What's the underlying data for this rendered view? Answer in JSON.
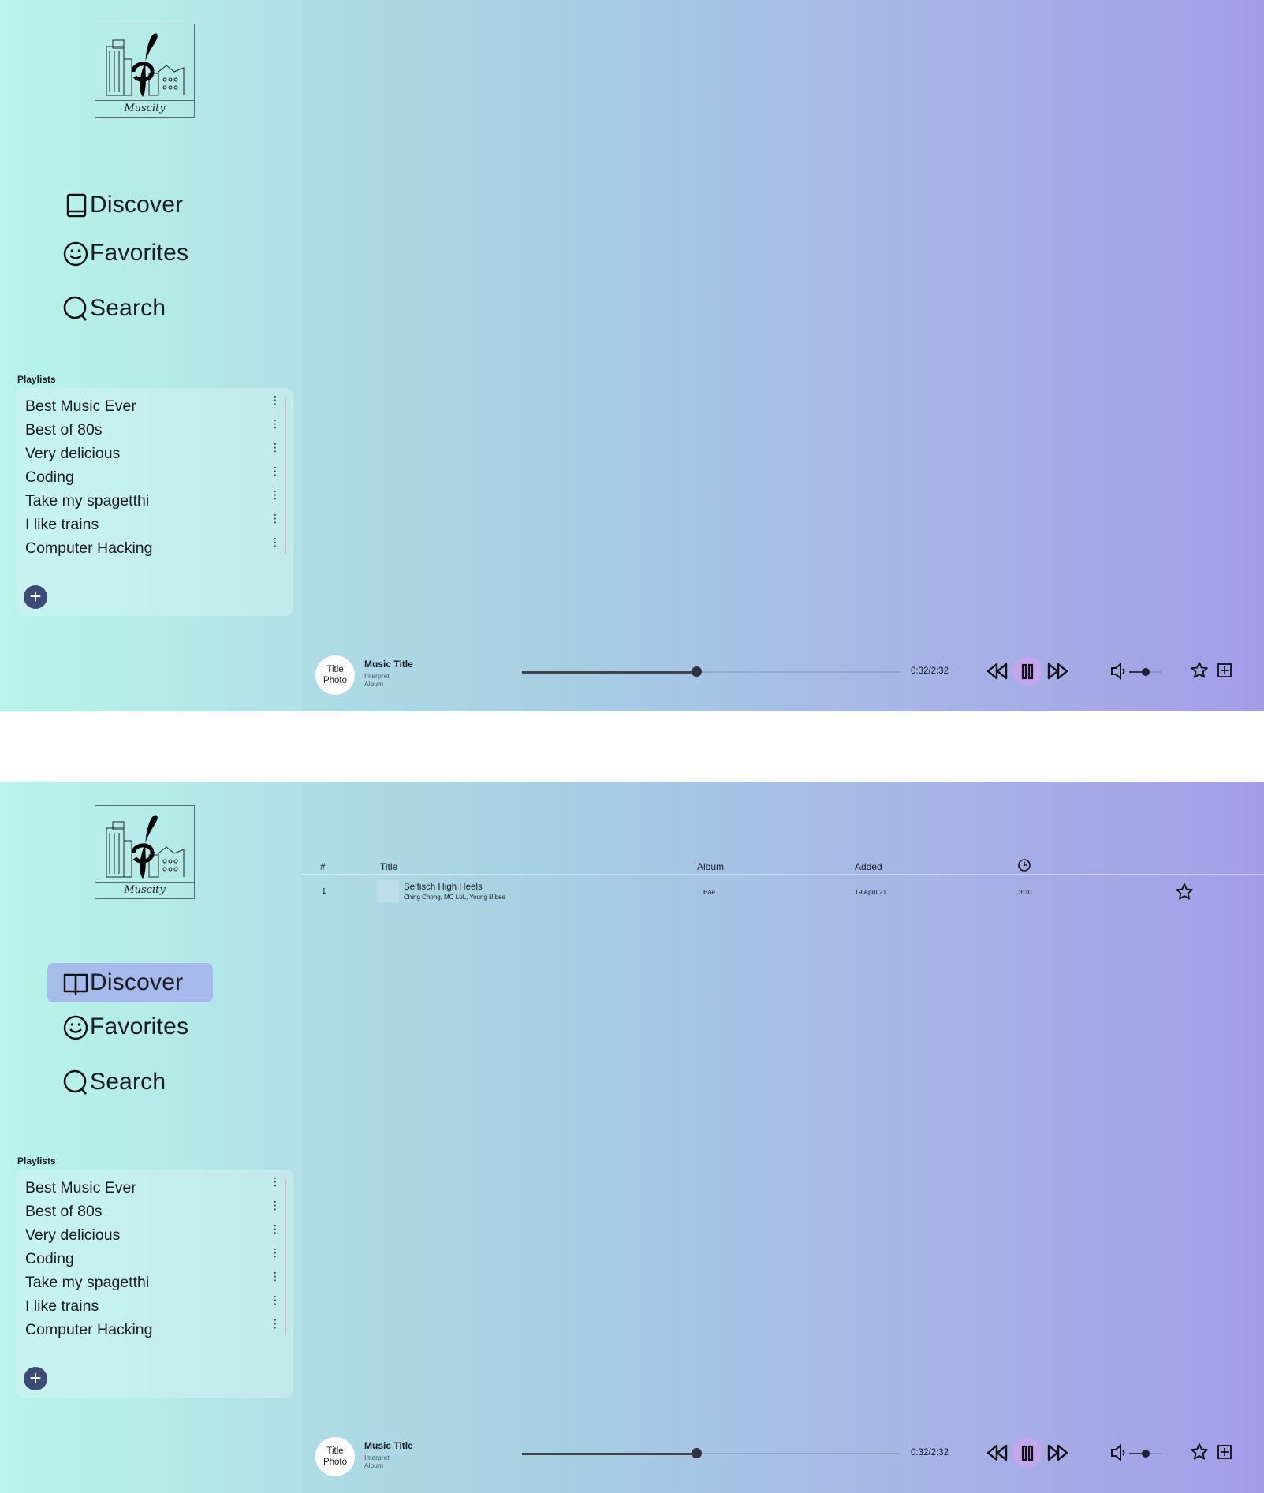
{
  "app": {
    "logo_text": "Muscity"
  },
  "nav": {
    "discover": "Discover",
    "favorites": "Favorites",
    "search": "Search"
  },
  "playlists": {
    "title": "Playlists",
    "items": [
      "Best Music Ever",
      "Best of 80s",
      "Very delicious",
      "Coding",
      "Take my spagetthi",
      "I like trains",
      "Computer Hacking"
    ],
    "more_glyph": "⋮",
    "add_glyph": "+"
  },
  "player": {
    "cover_line1": "Title",
    "cover_line2": "Photo",
    "title": "Music Title",
    "interpret": "Interpret",
    "album": "Album",
    "time": "0:32/2:32",
    "progress": 0.46,
    "volume": 0.5
  },
  "tracks": {
    "headers": {
      "num": "#",
      "title": "Title",
      "album": "Album",
      "added": "Added"
    },
    "rows": [
      {
        "num": "1",
        "title": "Selfisch High Heels",
        "artists": "Ching Chong, MC LoL, Young lil bee",
        "album": "Bae",
        "added": "19 April 21",
        "duration": "3:30"
      }
    ]
  },
  "colors": {
    "accent_nav": "#a0aaeb",
    "add_button": "#3d4a76",
    "pause_bg": "#c8a5eb"
  },
  "icons": [
    "book-icon",
    "smiley-icon",
    "search-icon",
    "more-vertical-icon",
    "plus-icon",
    "rewind-icon",
    "pause-icon",
    "fast-forward-icon",
    "volume-icon",
    "star-icon",
    "add-to-playlist-icon",
    "clock-icon"
  ]
}
